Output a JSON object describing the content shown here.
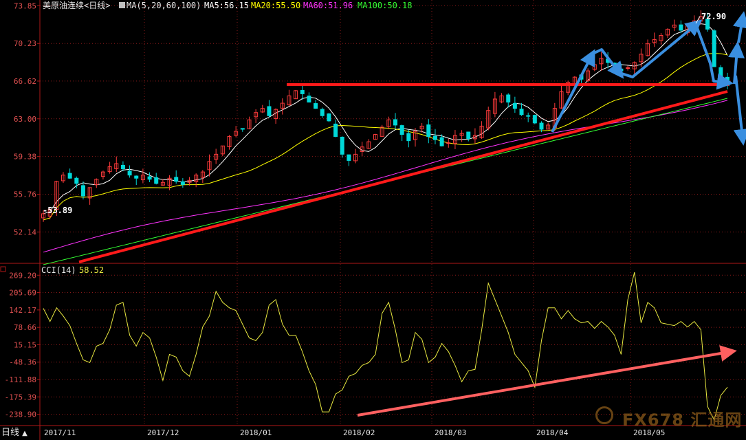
{
  "header": {
    "title": "美原油连续<日线>",
    "ma_params": "MA(5,20,60,100)",
    "ma5": "MA5:56.15",
    "ma20": "MA20:55.50",
    "ma60": "MA60:51.96",
    "ma100": "MA100:50.18"
  },
  "sub_header": {
    "cci_label": "CCI(14)",
    "cci_value": "58.52"
  },
  "bottom_bar": {
    "period_label": "日线",
    "period_arrow": "▲"
  },
  "watermark": {
    "text": "FX678 汇通网"
  },
  "colors": {
    "up": "#ff3b3b",
    "down": "#00d8d8",
    "ma5": "#ffffff",
    "ma20": "#ffff00",
    "ma60": "#ff33ff",
    "ma100": "#33ff33",
    "cci": "#e8e840",
    "axis": "#b01818",
    "trend": "#ff1a1a",
    "blue_arrow": "#3a8fe0",
    "pink_arrow": "#ff6060"
  },
  "chart_data": [
    {
      "type": "candlestick",
      "title": "美原油连续<日线>",
      "ylim": [
        49.2,
        74.4
      ],
      "y_ticks": [
        "73.85",
        "70.23",
        "66.62",
        "63.00",
        "59.38",
        "55.76",
        "52.14"
      ],
      "x_ticks": [
        "2017/11",
        "2017/12",
        "2018/01",
        "2018/02",
        "2018/03",
        "2018/04",
        "2018/05"
      ],
      "annotations": {
        "high_label": "72.90",
        "low_label": "53.89"
      },
      "series": [
        {
          "name": "MA5"
        },
        {
          "name": "MA20"
        },
        {
          "name": "MA60"
        },
        {
          "name": "MA100"
        }
      ],
      "price_path": [
        [
          53.89,
          54.3,
          57.0,
          57.6,
          57.3,
          56.8,
          55.6,
          56.4,
          57.2,
          57.9,
          58.4,
          58.7,
          58.2,
          57.6,
          57.3,
          57.6,
          57.2,
          56.8,
          56.9,
          57.3,
          57.0,
          56.7,
          57.1,
          57.6,
          57.9,
          58.9,
          59.6,
          60.4,
          61.3,
          61.8,
          62.0,
          62.9,
          63.6,
          64.0,
          63.3,
          63.9,
          64.5,
          65.2,
          65.7,
          65.4,
          64.6,
          64.0,
          63.3,
          62.8,
          61.3,
          59.6,
          59.0,
          59.6,
          60.3,
          60.8,
          61.5,
          62.2,
          62.9,
          62.4,
          61.5,
          60.9,
          61.8,
          62.3,
          61.3,
          61.0,
          60.4,
          60.7,
          61.4,
          61.6,
          61.1,
          61.4,
          62.3,
          63.8,
          64.9,
          65.2,
          64.6,
          64.0,
          63.4,
          63.3,
          62.6,
          62.0,
          62.4,
          64.0,
          65.6,
          66.5,
          67.0,
          66.8,
          67.6,
          68.2,
          68.8,
          68.4,
          68.0,
          67.6,
          67.9,
          68.4,
          69.2,
          70.2,
          70.6,
          71.0,
          71.6,
          72.0,
          71.5,
          71.9,
          72.4,
          72.8,
          71.6,
          68.0,
          66.8,
          66.2
        ]
      ],
      "blue_arrows": "zigzag pattern from 2018/04 up to 72.90 high then down",
      "trendlines": "horizontal red resistance near 66.62; rising red support line"
    },
    {
      "type": "line",
      "title": "CCI(14)",
      "ylim": [
        -270,
        300
      ],
      "y_ticks": [
        "269.20",
        "205.69",
        "142.17",
        "78.66",
        "15.15",
        "-48.36",
        "-111.88",
        "-175.39",
        "-238.90"
      ],
      "series": [
        {
          "name": "CCI",
          "values": [
            148,
            100,
            150,
            120,
            85,
            20,
            -40,
            -50,
            10,
            20,
            70,
            160,
            170,
            50,
            10,
            60,
            40,
            -30,
            -115,
            -20,
            -30,
            -80,
            -100,
            -20,
            80,
            120,
            210,
            170,
            150,
            140,
            90,
            40,
            30,
            60,
            160,
            180,
            90,
            50,
            50,
            -10,
            -80,
            -130,
            -230,
            -230,
            -165,
            -150,
            -100,
            -90,
            -60,
            -50,
            -20,
            130,
            170,
            70,
            -50,
            -40,
            60,
            35,
            -50,
            -30,
            20,
            -10,
            -60,
            -120,
            -80,
            -75,
            70,
            240,
            180,
            120,
            60,
            -20,
            -50,
            -80,
            -140,
            30,
            150,
            150,
            110,
            140,
            110,
            95,
            100,
            75,
            100,
            80,
            50,
            -20,
            180,
            280,
            95,
            170,
            150,
            95,
            90,
            85,
            100,
            80,
            100,
            70,
            -210,
            -260,
            -170,
            -140
          ]
        }
      ],
      "trend_arrow": "rising pink divergence arrow"
    }
  ]
}
